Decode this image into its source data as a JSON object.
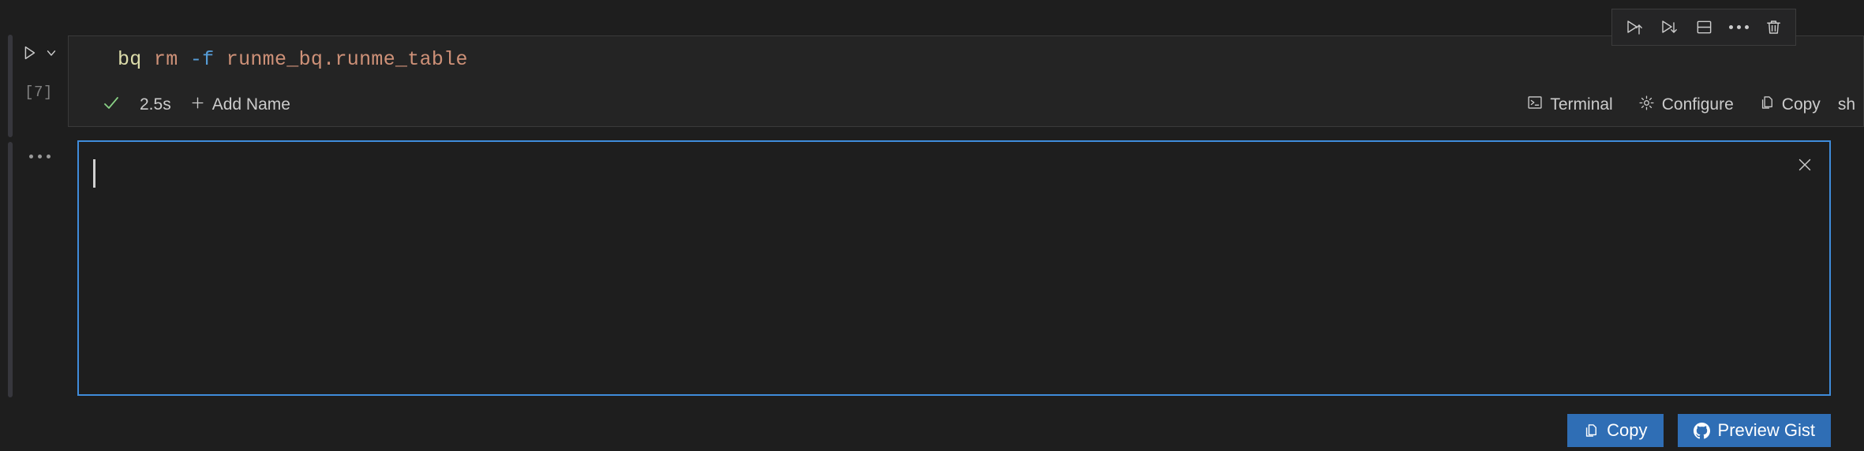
{
  "cell": {
    "execution_count": "[7]",
    "run_button_title": "Run Cell",
    "expand_chevron_title": "Toggle Cell",
    "code": {
      "language": "sh",
      "tokens": [
        {
          "text": "bq",
          "kind": "cmd"
        },
        {
          "text": " ",
          "kind": "plain"
        },
        {
          "text": "rm",
          "kind": "arg"
        },
        {
          "text": " ",
          "kind": "plain"
        },
        {
          "text": "-f",
          "kind": "flag"
        },
        {
          "text": " ",
          "kind": "plain"
        },
        {
          "text": "runme_bq.runme_table",
          "kind": "arg"
        }
      ],
      "plain": "bq rm -f runme_bq.runme_table"
    },
    "status": {
      "success_icon": "check-icon",
      "duration": "2.5s",
      "add_name_icon": "plus-icon",
      "add_name_label": "Add Name",
      "terminal_icon": "terminal-icon",
      "terminal_label": "Terminal",
      "configure_icon": "gear-icon",
      "configure_label": "Configure",
      "copy_icon": "copy-icon",
      "copy_label": "Copy",
      "language_label": "sh"
    }
  },
  "toolbar": {
    "run_above_icon": "run-above-icon",
    "run_above_title": "Execute Above Cells",
    "run_below_icon": "run-below-icon",
    "run_below_title": "Execute Cell and Below",
    "split_icon": "split-cell-icon",
    "split_title": "Split Cell",
    "more_icon": "more-actions-icon",
    "more_title": "More Actions...",
    "delete_icon": "trash-icon",
    "delete_title": "Delete Cell"
  },
  "output": {
    "gutter_more_icon": "more-actions-icon",
    "close_icon": "close-icon",
    "close_title": "Clear Cell Outputs",
    "terminal_text": "",
    "border_color": "#3f8cdb",
    "actions": [
      {
        "icon": "copy-icon",
        "label": "Copy"
      },
      {
        "icon": "github-icon",
        "label": "Preview Gist"
      }
    ]
  },
  "theme": {
    "background": "#1e1e1e",
    "cell_background": "#242424",
    "accent_blue": "#3f8cdb",
    "button_blue": "#2f6eb5",
    "success_green": "#89d185",
    "token_cmd": "#dcdcaa",
    "token_arg": "#ce9178",
    "token_flag": "#569cd6"
  }
}
